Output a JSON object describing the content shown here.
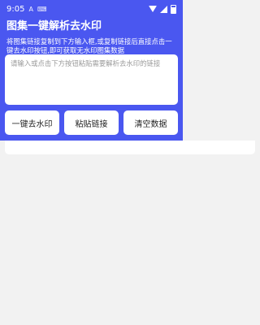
{
  "status": {
    "time": "9:05",
    "icons": [
      "notification-a-icon",
      "keyboard-icon"
    ],
    "right_icons": [
      "wifi-icon",
      "signal-icon",
      "battery-icon"
    ]
  },
  "header": {
    "title": "图集一键解析去水印",
    "description": "将图集链接复制到下方输入框,或复制链接后直接点击一键去水印按钮,即可获取无水印图集数据"
  },
  "input": {
    "placeholder": "请输入或点击下方按钮粘贴需要解析去水印的链接",
    "value": ""
  },
  "buttons": {
    "remove_watermark": "一键去水印",
    "paste_link": "粘贴链接",
    "clear_data": "清空数据"
  },
  "colors": {
    "primary": "#4a57f0",
    "background": "#f2f2f2",
    "card": "#ffffff"
  }
}
